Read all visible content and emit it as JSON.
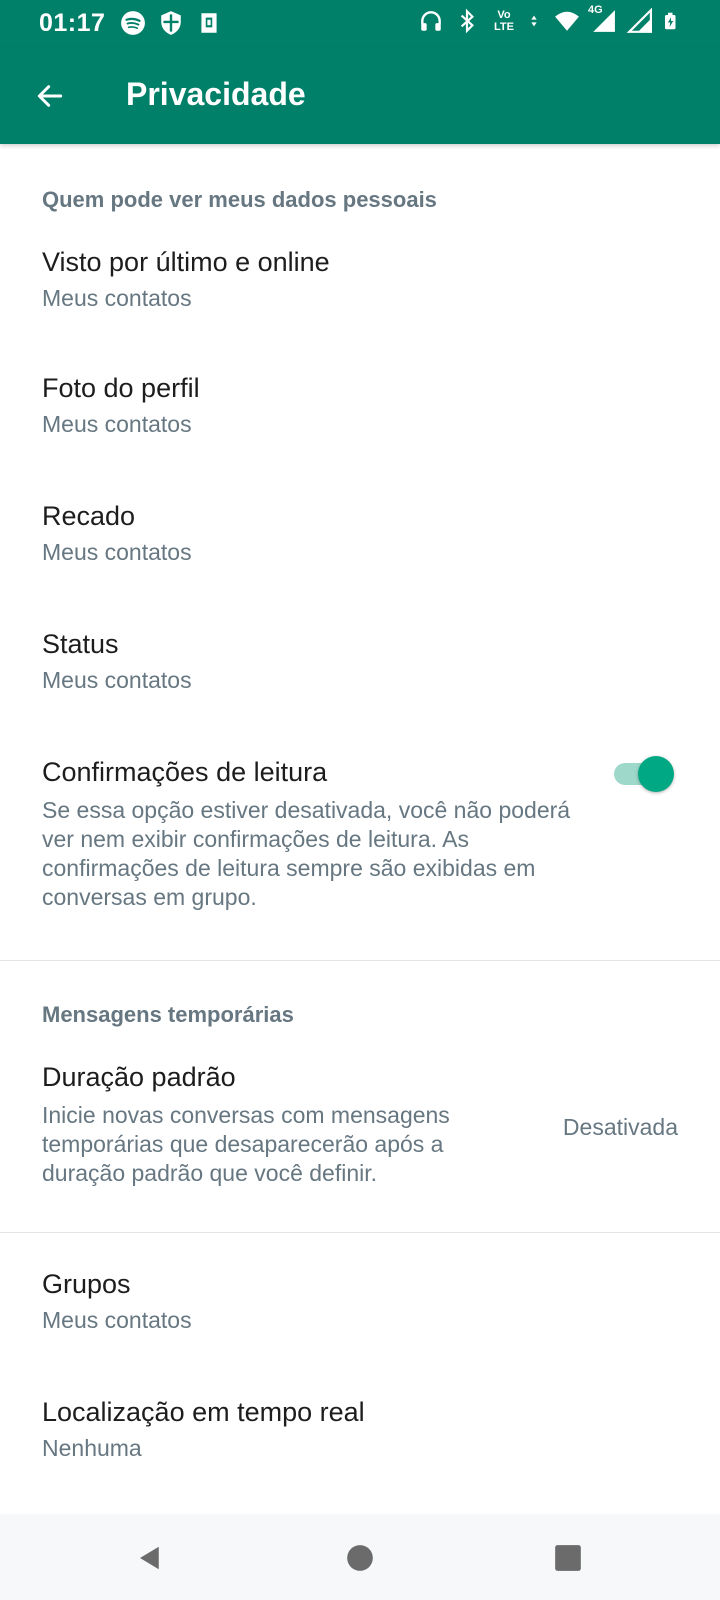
{
  "status_bar": {
    "time": "01:17",
    "left_icons": [
      "spotify-icon",
      "shield-icon",
      "sim-icon"
    ],
    "right_icons": [
      "headphones-icon",
      "bluetooth-icon",
      "volte-icon",
      "data-arrows-icon",
      "wifi-icon",
      "signal-4g-icon",
      "signal-icon",
      "battery-icon"
    ],
    "volte_line1": "Vo",
    "volte_line2": "LTE",
    "network": "4G"
  },
  "app_bar": {
    "title": "Privacidade",
    "back_icon": "arrow-left-icon",
    "background": "#008069"
  },
  "sections": {
    "personal": {
      "header": "Quem pode ver meus dados pessoais",
      "items": [
        {
          "title": "Visto por último e online",
          "subtitle": "Meus contatos"
        },
        {
          "title": "Foto do perfil",
          "subtitle": "Meus contatos"
        },
        {
          "title": "Recado",
          "subtitle": "Meus contatos"
        },
        {
          "title": "Status",
          "subtitle": "Meus contatos"
        }
      ],
      "read_receipts": {
        "title": "Confirmações de leitura",
        "description": "Se essa opção estiver desativada, você não poderá ver nem exibir confirmações de leitura. As confirmações de leitura sempre são exibidas em conversas em grupo.",
        "enabled": true,
        "accent": "#00a884"
      }
    },
    "temporary": {
      "header": "Mensagens temporárias",
      "default_duration": {
        "title": "Duração padrão",
        "description": "Inicie novas conversas com mensagens temporárias que desaparecerão após a duração padrão que você definir.",
        "value": "Desativada"
      }
    },
    "more": {
      "items": [
        {
          "title": "Grupos",
          "subtitle": "Meus contatos"
        },
        {
          "title": "Localização em tempo real",
          "subtitle": "Nenhuma"
        }
      ]
    }
  },
  "nav_bar": {
    "buttons": [
      "back-triangle-icon",
      "home-circle-icon",
      "recents-square-icon"
    ]
  }
}
